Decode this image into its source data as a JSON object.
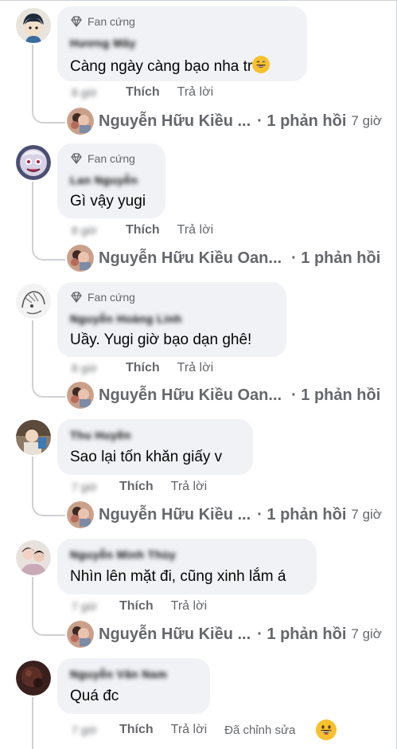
{
  "comments": [
    {
      "badge": "Fan cứng",
      "author": "Hương Mây",
      "text": "Càng ngày càng bạo nha tr",
      "time": "8 giờ",
      "like": "Thích",
      "reply": "Trả lời",
      "replies": {
        "name": "Nguyễn Hữu Kiều ...",
        "count": "· 1 phản hồi",
        "time": "7 giờ"
      }
    },
    {
      "badge": "Fan cứng",
      "author": "Lan Nguyễn",
      "text": "Gì vậy yugi",
      "time": "8 giờ",
      "like": "Thích",
      "reply": "Trả lời",
      "replies": {
        "name": "Nguyễn Hữu Kiều Oan...",
        "count": "· 1 phản hồi"
      }
    },
    {
      "badge": "Fan cứng",
      "author": "Nguyễn Hoàng Linh",
      "text": "Uầy. Yugi giờ bạo dạn ghê!",
      "time": "8 giờ",
      "like": "Thích",
      "reply": "Trả lời",
      "replies": {
        "name": "Nguyễn Hữu Kiều Oan...",
        "count": "· 1 phản hồi"
      }
    },
    {
      "author": "Thu Huyền",
      "text": "Sao lại tốn khăn giấy v",
      "time": "7 giờ",
      "like": "Thích",
      "reply": "Trả lời",
      "replies": {
        "name": "Nguyễn Hữu Kiều ...",
        "count": "· 1 phản hồi",
        "time": "7 giờ"
      }
    },
    {
      "author": "Nguyễn Minh Thùy",
      "text": "Nhìn lên mặt đi, cũng xinh lắm á",
      "time": "7 giờ",
      "like": "Thích",
      "reply": "Trả lời",
      "replies": {
        "name": "Nguyễn Hữu Kiều ...",
        "count": "· 1 phản hồi",
        "time": "7 giờ"
      }
    },
    {
      "author": "Nguyễn Văn Nam",
      "text": "Quá đc",
      "time": "7 giờ",
      "like": "Thích",
      "reply": "Trả lời",
      "edited": "Đã chỉnh sửa"
    }
  ],
  "colors": {
    "bubble": "#f0f2f5",
    "secondary_text": "#65676b",
    "thread_line": "#ced0d4",
    "emoji": "#f7c02e"
  },
  "icons": {
    "badge": "diamond-icon",
    "reaction": "grinning-emoji-icon"
  }
}
